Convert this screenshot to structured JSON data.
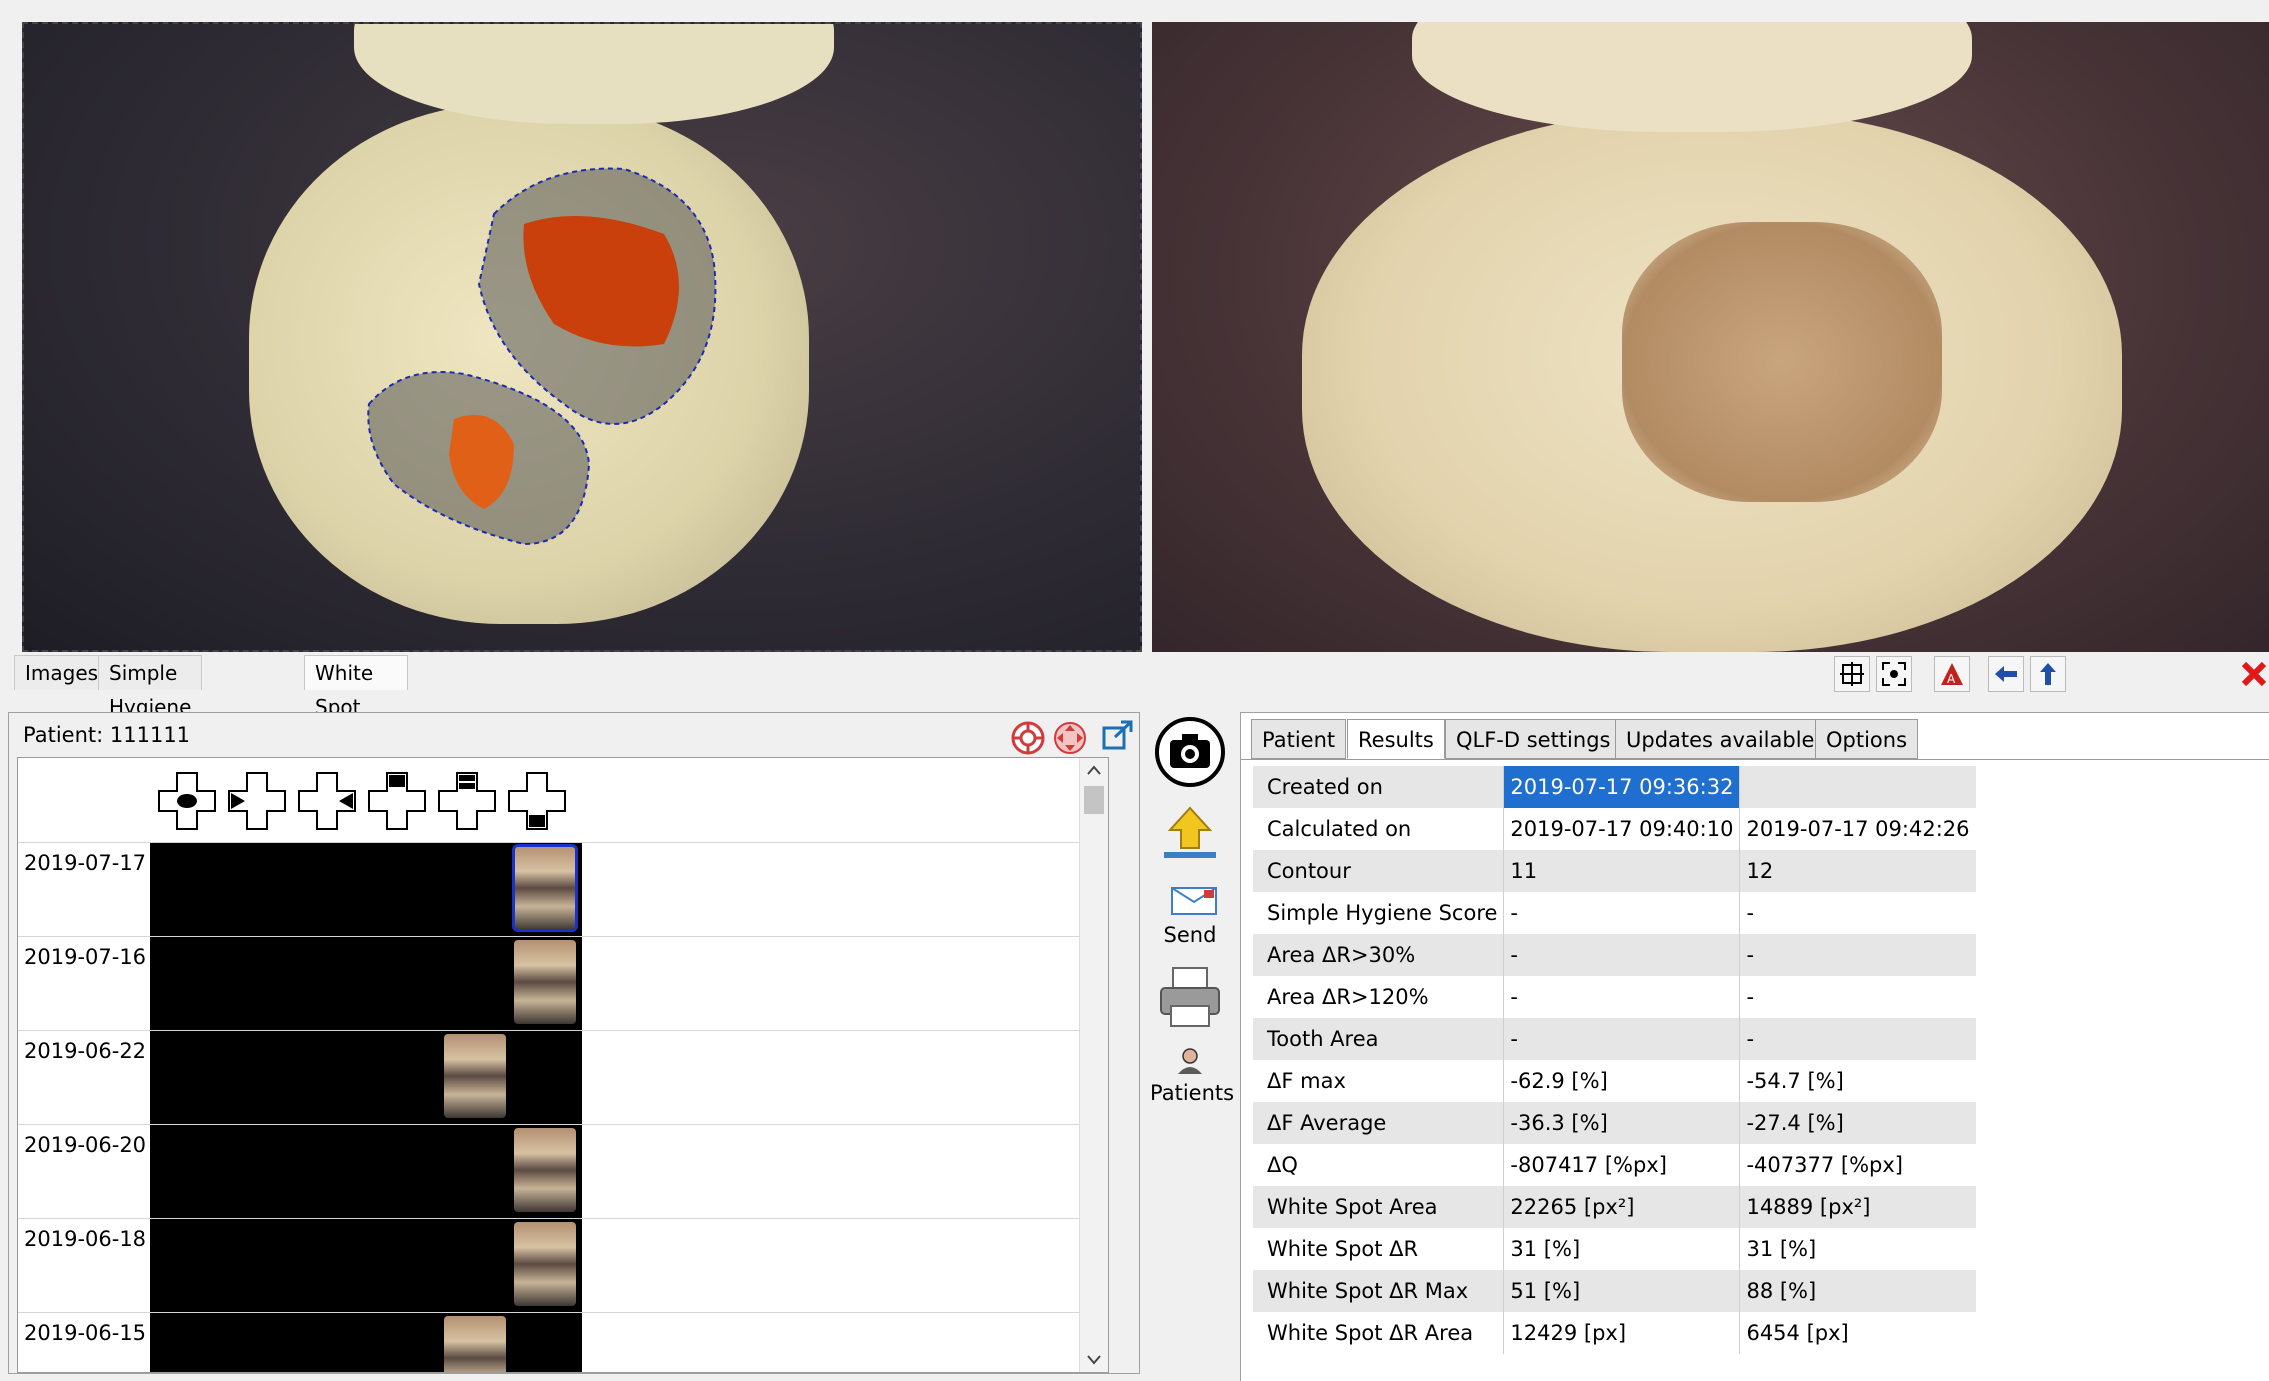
{
  "viewer_tabs": [
    {
      "label": "Images"
    },
    {
      "label": "Simple Hygiene Score"
    },
    {
      "label": "White Spot Analysis"
    }
  ],
  "toolbar_icons": [
    "crosshair-icon",
    "fit-screen-icon",
    "contrast-icon",
    "arrow-left-icon",
    "arrow-up-icon",
    "close-icon"
  ],
  "patient": {
    "title": "Patient: 111111",
    "dates": [
      "2019-07-17",
      "2019-07-16",
      "2019-06-22",
      "2019-06-20",
      "2019-06-18",
      "2019-06-15"
    ]
  },
  "side_buttons": {
    "send": "Send",
    "patients": "Patients"
  },
  "results": {
    "tabs": [
      "Patient",
      "Results",
      "QLF-D settings",
      "Updates available",
      "Options"
    ],
    "active_tab": "Results",
    "rows": [
      {
        "label": "Created on",
        "v1": "2019-07-17 09:36:32",
        "v2": ""
      },
      {
        "label": "Calculated on",
        "v1": "2019-07-17 09:40:10",
        "v2": "2019-07-17 09:42:26"
      },
      {
        "label": "Contour",
        "v1": "11",
        "v2": "12"
      },
      {
        "label": "Simple Hygiene Score",
        "v1": "-",
        "v2": "-"
      },
      {
        "label": "Area ΔR>30%",
        "v1": "-",
        "v2": "-"
      },
      {
        "label": "Area ΔR>120%",
        "v1": "-",
        "v2": "-"
      },
      {
        "label": "Tooth Area",
        "v1": "-",
        "v2": "-"
      },
      {
        "label": "ΔF max",
        "v1": "-62.9 [%]",
        "v2": "-54.7 [%]"
      },
      {
        "label": "ΔF Average",
        "v1": "-36.3 [%]",
        "v2": "-27.4 [%]"
      },
      {
        "label": "ΔQ",
        "v1": "-807417 [%px]",
        "v2": "-407377 [%px]"
      },
      {
        "label": "White Spot Area",
        "v1": "22265 [px²]",
        "v2": "14889 [px²]"
      },
      {
        "label": "White Spot ΔR",
        "v1": "31 [%]",
        "v2": "31 [%]"
      },
      {
        "label": "White Spot ΔR Max",
        "v1": "51 [%]",
        "v2": "88 [%]"
      },
      {
        "label": "White Spot ΔR Area",
        "v1": "12429 [px]",
        "v2": "6454 [px]"
      }
    ]
  },
  "colors": {
    "selection": "#1e6fcf",
    "thumb_outline": "#1a32c7",
    "lesion": "#d84a12"
  }
}
